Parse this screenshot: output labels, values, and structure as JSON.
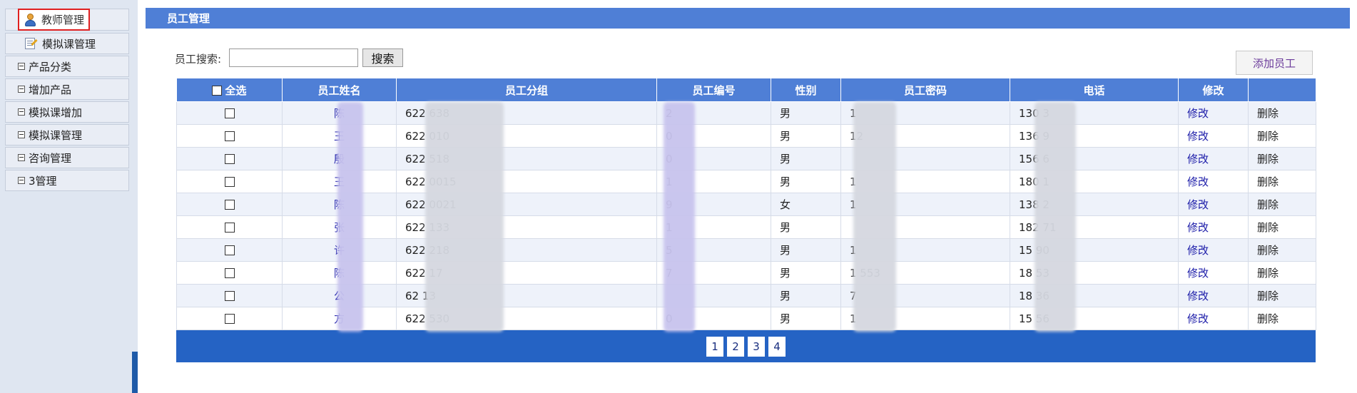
{
  "sidebar": {
    "active_item": "教师管理",
    "sub_item": "模拟课管理",
    "groups": [
      "产品分类",
      "增加产品",
      "模拟课增加",
      "模拟课管理",
      "咨询管理",
      "3管理"
    ]
  },
  "main": {
    "title": "员工管理",
    "search_label": "员工搜索:",
    "search_value": "",
    "search_button": "搜索",
    "add_button": "添加员工",
    "columns": [
      "全选",
      "员工姓名",
      "员工分组",
      "员工编号",
      "性别",
      "员工密码",
      "电话",
      "修改",
      ""
    ],
    "rows": [
      {
        "name": "陈",
        "group": "622         638",
        "number": "2",
        "gender": "男",
        "password": "1",
        "phone": "130       3",
        "edit": "修改",
        "delete": "删除"
      },
      {
        "name": "王",
        "group": "622         010",
        "number": "0",
        "gender": "男",
        "password": "12",
        "phone": "136       9",
        "edit": "修改",
        "delete": "删除"
      },
      {
        "name": "殷",
        "group": "622         518",
        "number": "0",
        "gender": "男",
        "password": "",
        "phone": "156       6",
        "edit": "修改",
        "delete": "删除"
      },
      {
        "name": "王",
        "group": "622        0015",
        "number": "1",
        "gender": "男",
        "password": "1",
        "phone": "180       1",
        "edit": "修改",
        "delete": "删除"
      },
      {
        "name": "陈",
        "group": "622        0021",
        "number": "9",
        "gender": "女",
        "password": "1",
        "phone": "138       2",
        "edit": "修改",
        "delete": "删除"
      },
      {
        "name": "张",
        "group": "622         133",
        "number": "1",
        "gender": "男",
        "password": "",
        "phone": "182       71",
        "edit": "修改",
        "delete": "删除"
      },
      {
        "name": "许",
        "group": "622         218",
        "number": "5",
        "gender": "男",
        "password": "1",
        "phone": "15       90",
        "edit": "修改",
        "delete": "删除"
      },
      {
        "name": "陈",
        "group": "622          17",
        "number": "7",
        "gender": "男",
        "password": "1        553",
        "phone": "18       53",
        "edit": "修改",
        "delete": "删除"
      },
      {
        "name": "公",
        "group": "62           13",
        "number": "",
        "gender": "男",
        "password": "7",
        "phone": "18       36",
        "edit": "修改",
        "delete": "删除"
      },
      {
        "name": "方",
        "group": "622         530",
        "number": "0",
        "gender": "男",
        "password": "1",
        "phone": "15       56",
        "edit": "修改",
        "delete": "删除"
      }
    ],
    "pages": [
      "1",
      "2",
      "3",
      "4"
    ]
  },
  "colors": {
    "header_blue": "#4f7fd6",
    "pager_blue": "#2563c4",
    "link": "#1a1aa8",
    "active_border": "#e02020"
  },
  "icons": {
    "active_item": "user-icon",
    "sub_item": "document-edit-icon",
    "group_toggle": "collapse-toggle-icon"
  }
}
